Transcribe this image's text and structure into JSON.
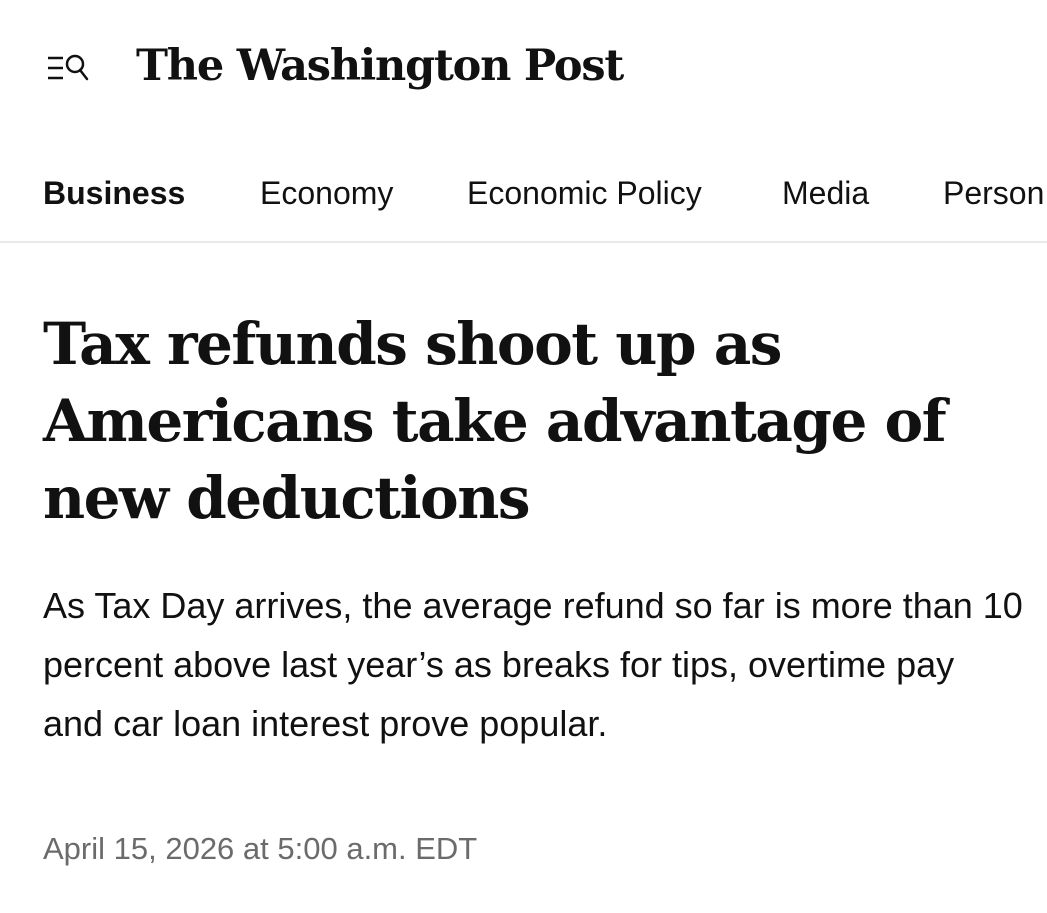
{
  "header": {
    "masthead": "The Washington Post",
    "menu_icon": "menu-search-icon"
  },
  "nav": {
    "items": [
      {
        "label": "Business",
        "active": true
      },
      {
        "label": "Economy",
        "active": false
      },
      {
        "label": "Economic Policy",
        "active": false
      },
      {
        "label": "Media",
        "active": false
      },
      {
        "label": "Person",
        "active": false
      }
    ]
  },
  "article": {
    "headline": "Tax refunds shoot up as Americans take advantage of new deductions",
    "dek": "As Tax Day arrives, the average refund so far is more than 10 percent above last year’s as breaks for tips, overtime pay and car loan interest prove popular.",
    "timestamp": "April 15, 2026 at 5:00 a.m. EDT"
  }
}
